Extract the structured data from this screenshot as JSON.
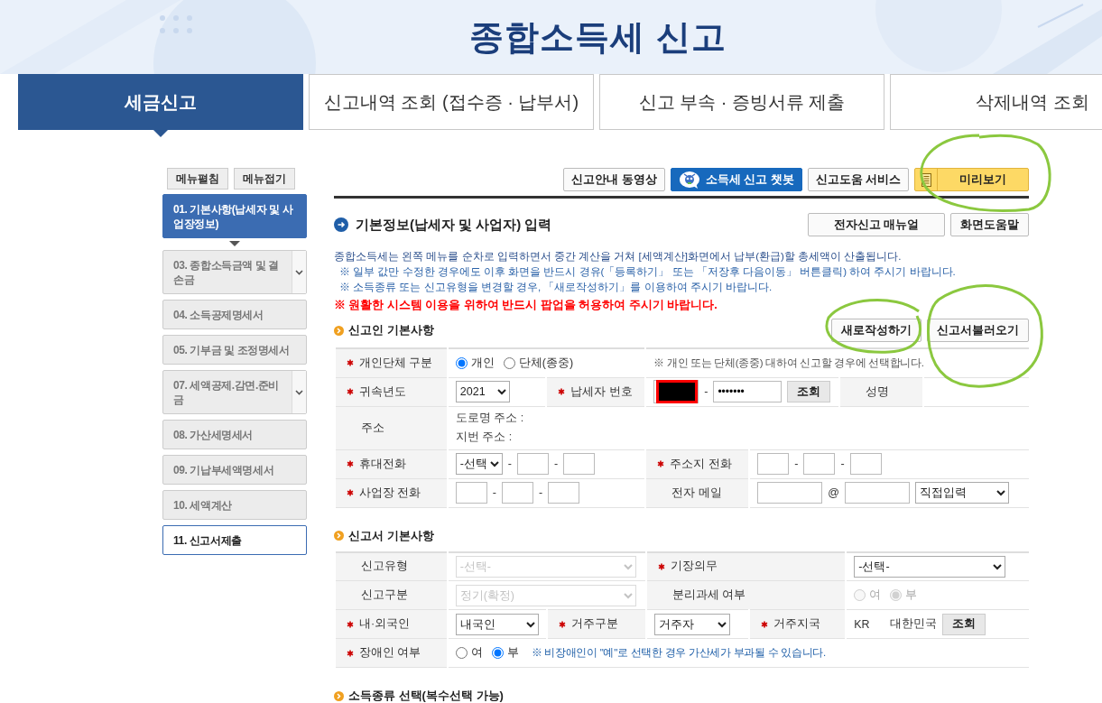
{
  "page_title": "종합소득세 신고",
  "tabs": [
    {
      "label": "세금신고",
      "selected": true
    },
    {
      "label": "신고내역 조회 (접수증 · 납부서)",
      "selected": false
    },
    {
      "label": "신고 부속 · 증빙서류 제출",
      "selected": false
    },
    {
      "label": "삭제내역 조회",
      "selected": false
    }
  ],
  "sidebar": {
    "buttons": [
      "메뉴펼침",
      "메뉴접기"
    ],
    "items": [
      {
        "label": "01. 기본사항(납세자 및 사업장정보)",
        "selected": true,
        "disabled": false,
        "expandable": false
      },
      {
        "label": "03. 종합소득금액 및 결손금",
        "selected": false,
        "disabled": true,
        "expandable": true
      },
      {
        "label": "04. 소득공제명세서",
        "selected": false,
        "disabled": true,
        "expandable": false
      },
      {
        "label": "05. 기부금 및 조정명세서",
        "selected": false,
        "disabled": true,
        "expandable": false
      },
      {
        "label": "07. 세액공제.감면.준비금",
        "selected": false,
        "disabled": true,
        "expandable": true
      },
      {
        "label": "08. 가산세명세서",
        "selected": false,
        "disabled": true,
        "expandable": false
      },
      {
        "label": "09. 기납부세액명세서",
        "selected": false,
        "disabled": true,
        "expandable": false
      },
      {
        "label": "10. 세액계산",
        "selected": false,
        "disabled": true,
        "expandable": false
      },
      {
        "label": "11. 신고서제출",
        "selected": false,
        "disabled": false,
        "expandable": false
      }
    ]
  },
  "toolbar": [
    {
      "label": "신고안내 동영상",
      "kind": "plain"
    },
    {
      "label": "소득세 신고 챗봇",
      "kind": "chatbot"
    },
    {
      "label": "신고도움 서비스",
      "kind": "plain"
    },
    {
      "label": "미리보기",
      "kind": "preview"
    }
  ],
  "section": {
    "title": "기본정보(납세자 및 사업자) 입력",
    "buttons": [
      "전자신고 매뉴얼",
      "화면도움말"
    ],
    "notices": [
      {
        "text": "종합소득세는 왼쪽 메뉴를 순차로 입력하면서 중간 계산을 거쳐 [세액계산]화면에서 납부(환급)할 총세액이 산출됩니다.",
        "kind": "intro"
      },
      {
        "text": "※ 일부 값만 수정한 경우에도 이후 화면을 반드시 경유(「등록하기」 또는 「저장후 다음이동」 버튼클릭) 하여 주시기 바랍니다.",
        "kind": "info"
      },
      {
        "text": "※ 소득종류 또는 신고유형을 변경할 경우, 「새로작성하기」를 이용하여 주시기 바랍니다.",
        "kind": "info"
      },
      {
        "text": "※ 원활한 시스템 이용을 위하여 반드시 팝업을 허용하여 주시기 바랍니다.",
        "kind": "warning"
      }
    ]
  },
  "filer_basics": {
    "title": "신고인 기본사항",
    "buttons": [
      "새로작성하기",
      "신고서불러오기"
    ],
    "rows": [
      [
        {
          "kind": "label",
          "text": "개인단체 구분",
          "required": true
        },
        {
          "kind": "radios",
          "colspan": 2,
          "disabled": false,
          "options": [
            {
              "label": "개인",
              "selected": true
            },
            {
              "label": "단체(종중)",
              "selected": false
            }
          ]
        },
        {
          "kind": "note",
          "colspan": 4,
          "text": "※ 개인 또는 단체(종중) 대하여 신고할 경우에 선택합니다."
        }
      ],
      [
        {
          "kind": "label",
          "text": "귀속년도",
          "required": true
        },
        {
          "kind": "select",
          "value": "2021",
          "disabled": false
        },
        {
          "kind": "label",
          "text": "납세자 번호",
          "required": true
        },
        {
          "kind": "taxpayer-id",
          "colspan": 2,
          "redacted": true,
          "separator": "-",
          "masked": "•••••••",
          "button": "조회"
        },
        {
          "kind": "label",
          "text": "성명",
          "required": false
        },
        {
          "kind": "empty"
        }
      ],
      [
        {
          "kind": "label",
          "text": "주소",
          "required": false
        },
        {
          "kind": "lines",
          "colspan": 6,
          "lines": [
            "도로명 주소 :",
            "지번 주소 :"
          ]
        }
      ],
      [
        {
          "kind": "label",
          "text": "휴대전화",
          "required": true
        },
        {
          "kind": "phone",
          "colspan": 2,
          "select": "-선택",
          "separator": "-"
        },
        {
          "kind": "label",
          "text": "주소지 전화",
          "required": true
        },
        {
          "kind": "phone",
          "colspan": 3,
          "separator": "-"
        }
      ],
      [
        {
          "kind": "label",
          "text": "사업장 전화",
          "required": true
        },
        {
          "kind": "phone",
          "colspan": 2,
          "separator": "-"
        },
        {
          "kind": "label",
          "text": "전자 메일",
          "required": false
        },
        {
          "kind": "email",
          "colspan": 3,
          "at": "@",
          "select": "직접입력"
        }
      ]
    ]
  },
  "return_basics": {
    "title": "신고서 기본사항",
    "rows": [
      [
        {
          "kind": "label",
          "text": "신고유형",
          "required": false
        },
        {
          "kind": "select",
          "colspan": 2,
          "value": "-선택-",
          "disabled": true
        },
        {
          "kind": "label",
          "colspan": 2,
          "text": "기장의무",
          "required": true
        },
        {
          "kind": "select",
          "value": "-선택-",
          "disabled": false
        }
      ],
      [
        {
          "kind": "label",
          "text": "신고구분",
          "required": false
        },
        {
          "kind": "select",
          "colspan": 2,
          "value": "정기(확정)",
          "disabled": true
        },
        {
          "kind": "label",
          "colspan": 2,
          "text": "분리과세 여부",
          "required": false
        },
        {
          "kind": "radios",
          "disabled": true,
          "options": [
            {
              "label": "여",
              "selected": false
            },
            {
              "label": "부",
              "selected": true
            }
          ]
        }
      ],
      [
        {
          "kind": "label",
          "text": "내·외국인",
          "required": true
        },
        {
          "kind": "select",
          "value": "내국인",
          "disabled": false
        },
        {
          "kind": "label",
          "text": "거주구분",
          "required": true
        },
        {
          "kind": "select",
          "value": "거주자",
          "disabled": false
        },
        {
          "kind": "label",
          "text": "거주지국",
          "required": true
        },
        {
          "kind": "country",
          "code": "KR",
          "name": "대한민국",
          "button": "조회"
        }
      ],
      [
        {
          "kind": "label",
          "text": "장애인 여부",
          "required": true
        },
        {
          "kind": "radios",
          "colspan": 5,
          "disabled": false,
          "options": [
            {
              "label": "여",
              "selected": false
            },
            {
              "label": "부",
              "selected": true
            }
          ],
          "note": "※ 비장애인이 \"예\"로 선택한 경우 가산세가 부과될 수 있습니다."
        }
      ]
    ]
  },
  "next_section": {
    "title": "소득종류 선택(복수선택 가능)"
  },
  "annotations": [
    {
      "kind": "circle"
    },
    {
      "kind": "circle"
    },
    {
      "kind": "circle"
    }
  ]
}
